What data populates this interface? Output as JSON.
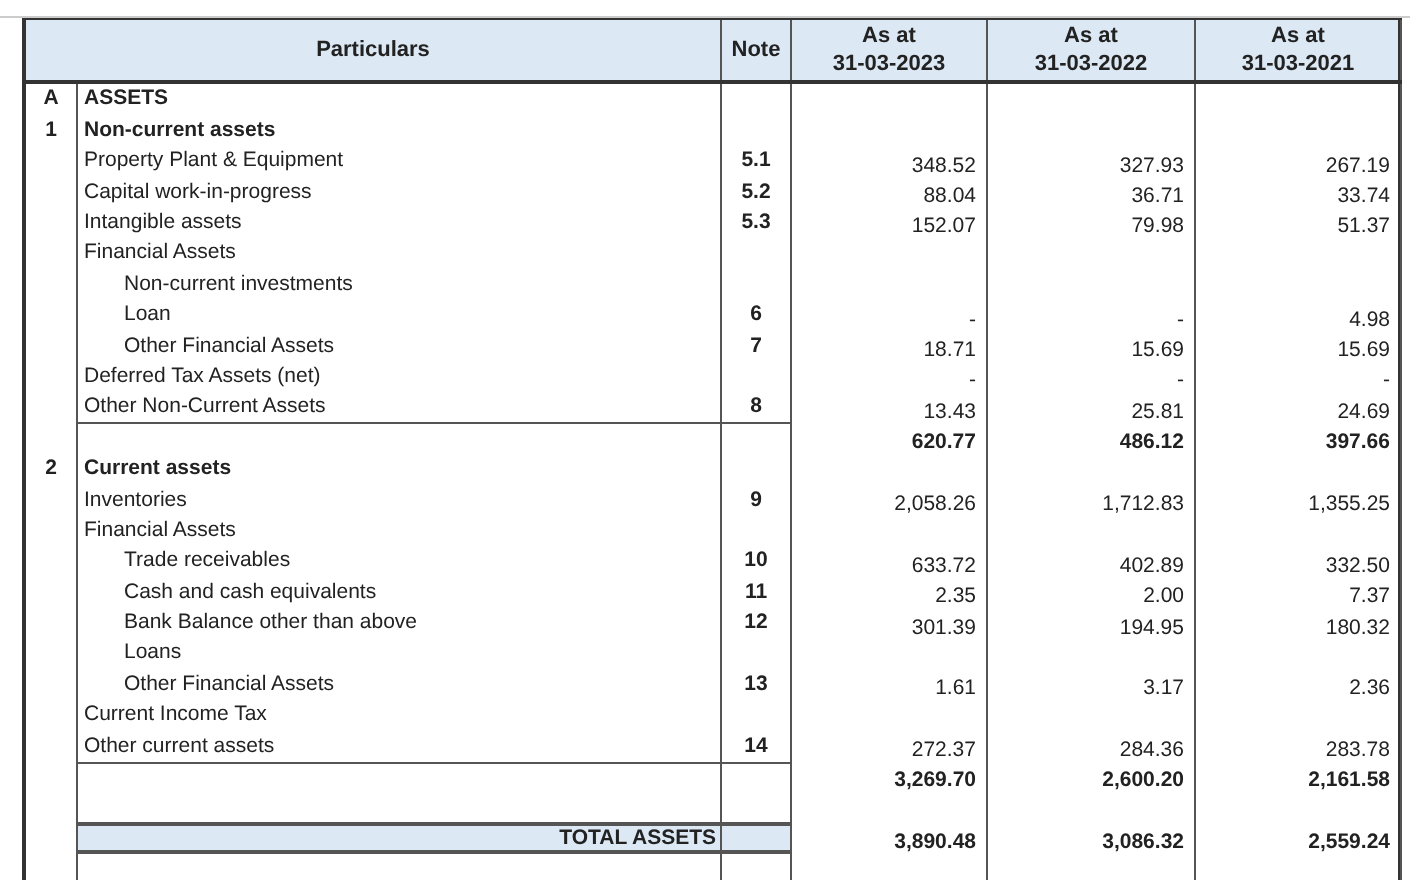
{
  "table": {
    "columns": [
      {
        "label": "Particulars"
      },
      {
        "label": "Note"
      },
      {
        "label": "As at",
        "date": "31-03-2023"
      },
      {
        "label": "As at",
        "date": "31-03-2022"
      },
      {
        "label": "As at",
        "date": "31-03-2021"
      }
    ],
    "rows": [
      {
        "kind": "section",
        "marker": "A",
        "label": "ASSETS"
      },
      {
        "kind": "section",
        "marker": "1",
        "label": "Non-current assets"
      },
      {
        "kind": "item",
        "label": "Property Plant & Equipment",
        "note": "5.1",
        "values": [
          "348.52",
          "327.93",
          "267.19"
        ]
      },
      {
        "kind": "item",
        "label": "Capital work-in-progress",
        "note": "5.2",
        "values": [
          "88.04",
          "36.71",
          "33.74"
        ]
      },
      {
        "kind": "item",
        "label": "Intangible assets",
        "note": "5.3",
        "values": [
          "152.07",
          "79.98",
          "51.37"
        ]
      },
      {
        "kind": "item",
        "label": "Financial Assets",
        "children": [
          {
            "kind": "item",
            "label": "Non-current investments"
          },
          {
            "kind": "item",
            "label": "Loan",
            "note": "6",
            "values": [
              "-",
              "-",
              "4.98"
            ]
          },
          {
            "kind": "item",
            "label": "Other Financial Assets",
            "note": "7",
            "values": [
              "18.71",
              "15.69",
              "15.69"
            ]
          }
        ]
      },
      {
        "kind": "item",
        "label": "Deferred Tax Assets (net)",
        "values": [
          "-",
          "-",
          "-"
        ]
      },
      {
        "kind": "item",
        "label": "Other Non-Current Assets",
        "note": "8",
        "values": [
          "13.43",
          "25.81",
          "24.69"
        ]
      },
      {
        "kind": "subtotal",
        "values": [
          "620.77",
          "486.12",
          "397.66"
        ]
      },
      {
        "kind": "section",
        "marker": "2",
        "label": "Current assets"
      },
      {
        "kind": "item",
        "label": "Inventories",
        "note": "9",
        "values": [
          "2,058.26",
          "1,712.83",
          "1,355.25"
        ]
      },
      {
        "kind": "item",
        "label": "Financial Assets",
        "children": [
          {
            "kind": "item",
            "label": "Trade receivables",
            "note": "10",
            "values": [
              "633.72",
              "402.89",
              "332.50"
            ]
          },
          {
            "kind": "item",
            "label": "Cash and cash equivalents",
            "note": "11",
            "values": [
              "2.35",
              "2.00",
              "7.37"
            ]
          },
          {
            "kind": "item",
            "label": "Bank Balance other than above",
            "note": "12",
            "values": [
              "301.39",
              "194.95",
              "180.32"
            ]
          },
          {
            "kind": "item",
            "label": "Loans"
          },
          {
            "kind": "item",
            "label": "Other Financial Assets",
            "note": "13",
            "values": [
              "1.61",
              "3.17",
              "2.36"
            ]
          }
        ]
      },
      {
        "kind": "item",
        "label": "Current Income Tax"
      },
      {
        "kind": "item",
        "label": "Other current assets",
        "note": "14",
        "values": [
          "272.37",
          "284.36",
          "283.78"
        ]
      },
      {
        "kind": "subtotal",
        "values": [
          "3,269.70",
          "2,600.20",
          "2,161.58"
        ]
      },
      {
        "kind": "spacer"
      },
      {
        "kind": "total",
        "total_label": "TOTAL ASSETS",
        "values": [
          "3,890.48",
          "3,086.32",
          "2,559.24"
        ]
      },
      {
        "kind": "spacer"
      }
    ]
  }
}
